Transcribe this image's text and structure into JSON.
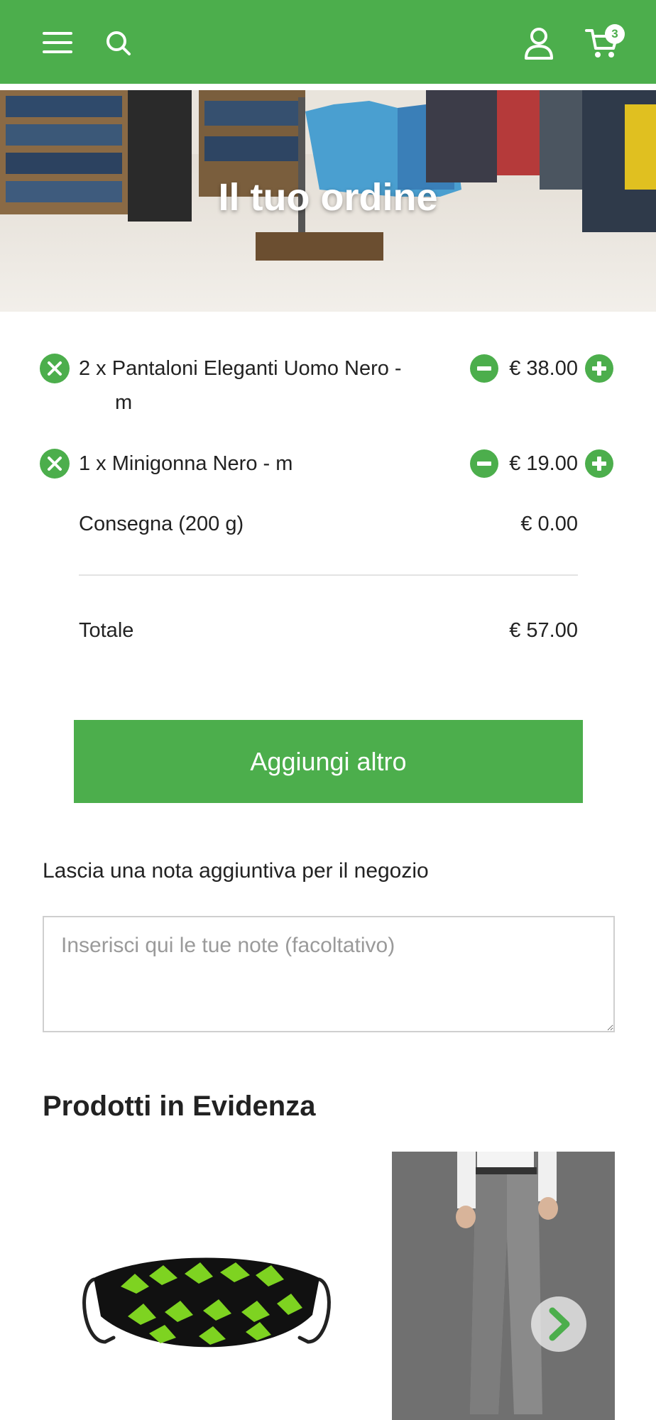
{
  "header": {
    "menu_icon": "hamburger-menu-icon",
    "search_icon": "search-icon",
    "account_icon": "user-account-icon",
    "cart_icon": "shopping-cart-icon",
    "cart_count": "3",
    "color": "#4cae4c"
  },
  "hero": {
    "title": "Il tuo ordine"
  },
  "order": {
    "items": [
      {
        "line1": "2 x Pantaloni Eleganti Uomo Nero -",
        "line2": "m",
        "price": "€ 38.00"
      },
      {
        "line1": "1 x Minigonna Nero - m",
        "price": "€ 19.00"
      }
    ],
    "delivery": {
      "label": "Consegna (200 g)",
      "price": "€ 0.00"
    },
    "total": {
      "label": "Totale",
      "price": "€ 57.00"
    }
  },
  "add_more": {
    "label": "Aggiungi altro"
  },
  "note": {
    "label": "Lascia una nota aggiuntiva per il negozio",
    "placeholder": "Inserisci qui le tue note (facoltativo)"
  },
  "featured": {
    "title": "Prodotti in Evidenza",
    "next_icon": "chevron-right-icon"
  }
}
